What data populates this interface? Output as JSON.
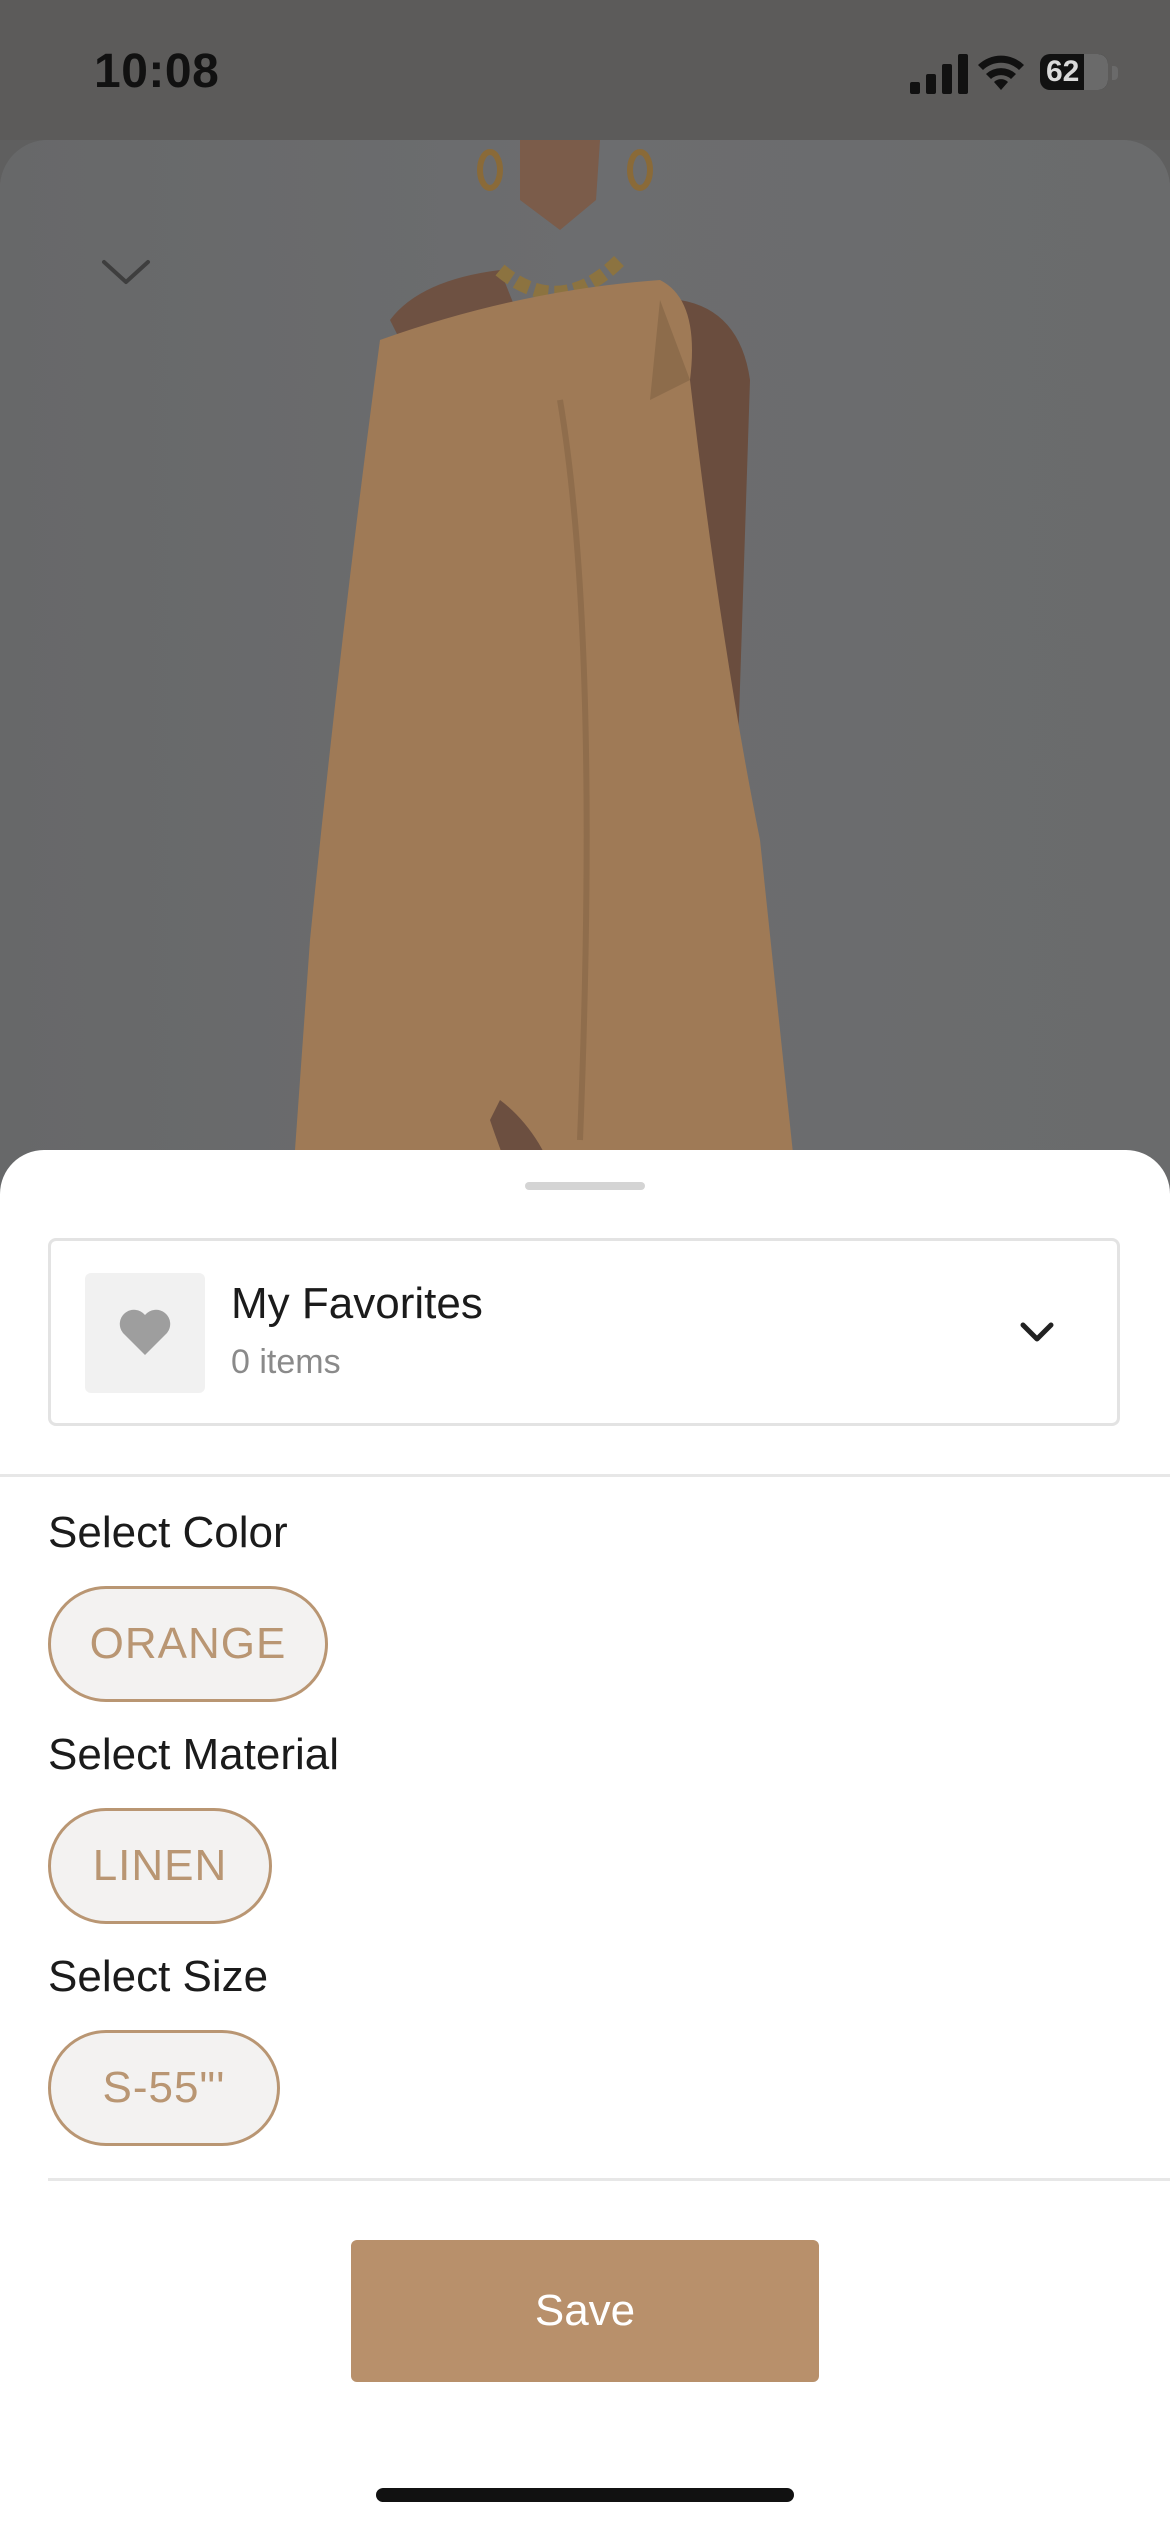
{
  "status_bar": {
    "time": "10:08",
    "battery_level": "62"
  },
  "product_image": {
    "description_icon": "collapse-chevron-icon"
  },
  "collection": {
    "name": "My Favorites",
    "count": "0 items",
    "icon": "heart-icon"
  },
  "options": {
    "color": {
      "label": "Select Color",
      "value": "ORANGE"
    },
    "material": {
      "label": "Select Material",
      "value": "LINEN"
    },
    "size": {
      "label": "Select Size",
      "value": "S-55\"'"
    }
  },
  "actions": {
    "save_label": "Save"
  },
  "colors": {
    "accent": "#b8906b",
    "pill_border": "#b99673",
    "dress": "#e9b16c"
  }
}
